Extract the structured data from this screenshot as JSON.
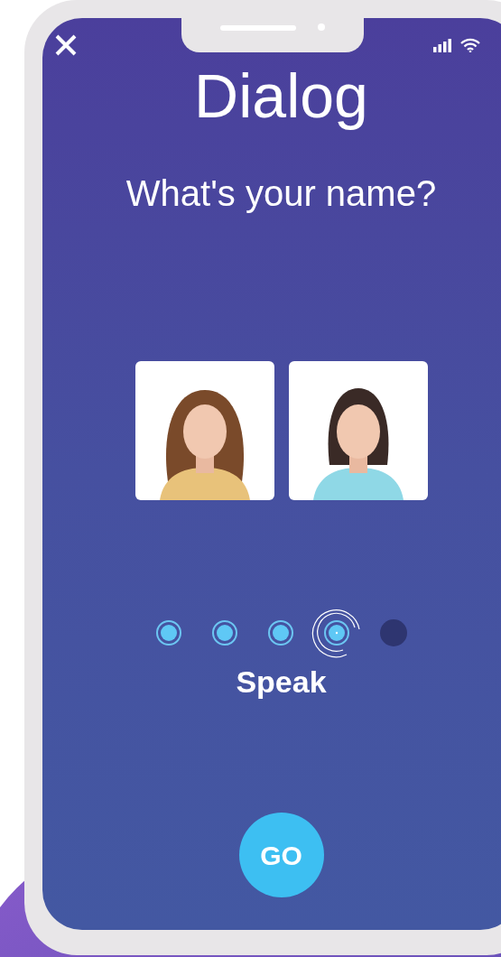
{
  "screen": {
    "title": "Dialog",
    "prompt": "What's your name?"
  },
  "speakers": [
    {
      "kind": "long-hair"
    },
    {
      "kind": "bob-hair"
    }
  ],
  "steps": [
    {
      "kind": "done"
    },
    {
      "kind": "done"
    },
    {
      "kind": "done"
    },
    {
      "kind": "current"
    },
    {
      "kind": "pending"
    }
  ],
  "step_label": "Speak",
  "go_button": "GO"
}
